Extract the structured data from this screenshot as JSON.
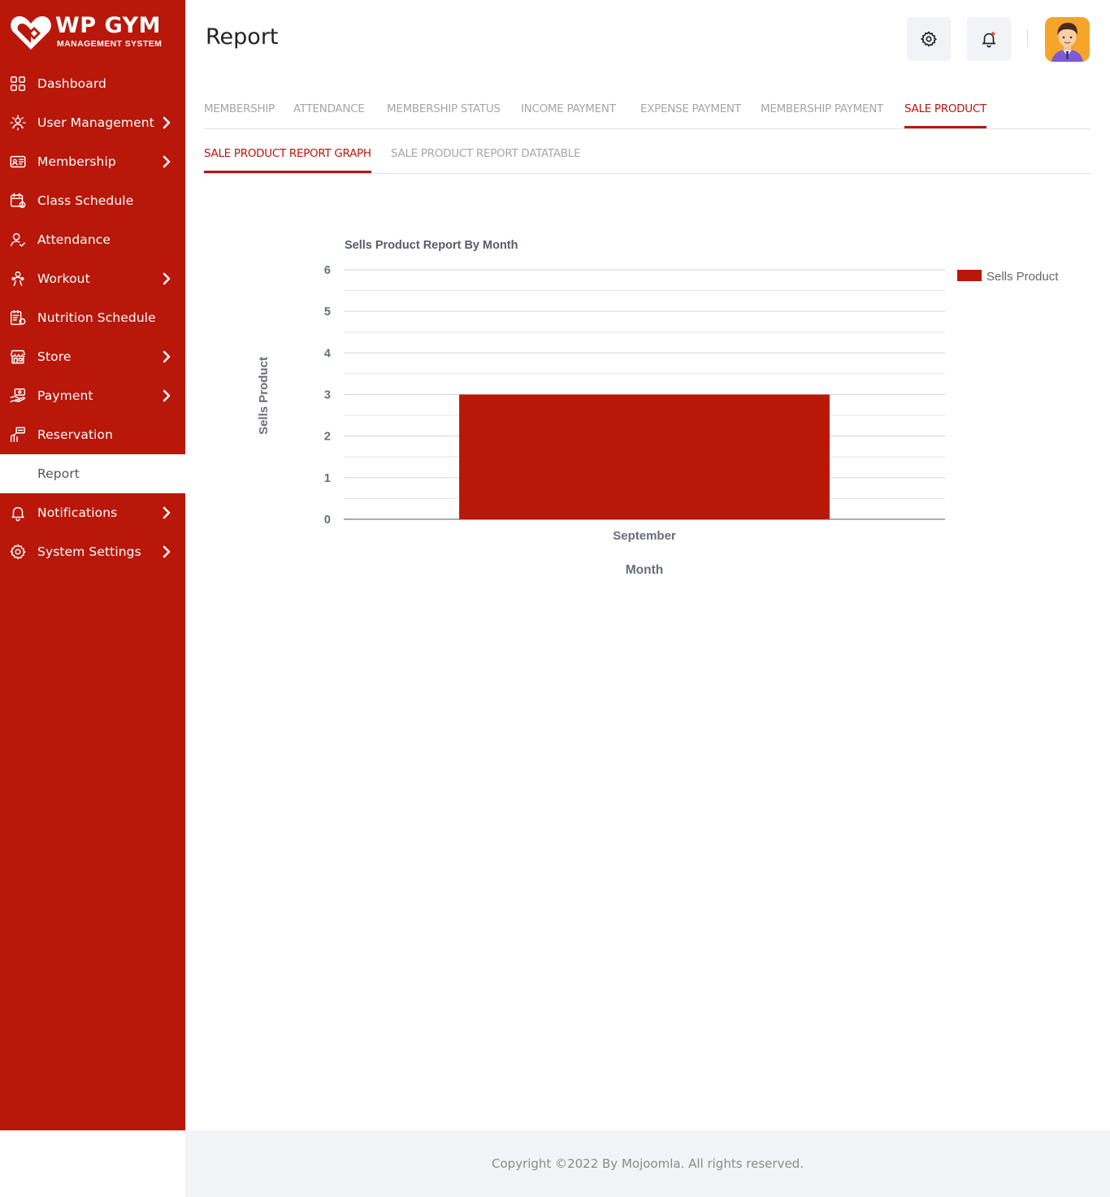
{
  "brand": {
    "title": "WP GYM",
    "subtitle": "MANAGEMENT SYSTEM"
  },
  "sidebar": {
    "items": [
      {
        "label": "Dashboard",
        "icon": "dashboard-icon",
        "has_submenu": false
      },
      {
        "label": "User Management",
        "icon": "users-gear-icon",
        "has_submenu": true
      },
      {
        "label": "Membership",
        "icon": "membership-card-icon",
        "has_submenu": true
      },
      {
        "label": "Class Schedule",
        "icon": "calendar-icon",
        "has_submenu": false
      },
      {
        "label": "Attendance",
        "icon": "user-check-icon",
        "has_submenu": false
      },
      {
        "label": "Workout",
        "icon": "workout-icon",
        "has_submenu": true
      },
      {
        "label": "Nutrition Schedule",
        "icon": "nutrition-icon",
        "has_submenu": false
      },
      {
        "label": "Store",
        "icon": "store-icon",
        "has_submenu": true
      },
      {
        "label": "Payment",
        "icon": "payment-icon",
        "has_submenu": true
      },
      {
        "label": "Reservation",
        "icon": "reservation-icon",
        "has_submenu": false
      },
      {
        "label": "Report",
        "icon": "report-icon",
        "has_submenu": false,
        "active": true
      },
      {
        "label": "Notifications",
        "icon": "bell-icon",
        "has_submenu": true
      },
      {
        "label": "System Settings",
        "icon": "gear-icon",
        "has_submenu": true
      }
    ]
  },
  "header": {
    "title": "Report"
  },
  "tabs": [
    {
      "label": "MEMBERSHIP"
    },
    {
      "label": "ATTENDANCE"
    },
    {
      "label": "MEMBERSHIP STATUS"
    },
    {
      "label": "INCOME PAYMENT"
    },
    {
      "label": "EXPENSE PAYMENT"
    },
    {
      "label": "MEMBERSHIP PAYMENT"
    },
    {
      "label": "SALE PRODUCT",
      "active": true
    }
  ],
  "subtabs": [
    {
      "label": "SALE PRODUCT REPORT GRAPH",
      "active": true
    },
    {
      "label": "SALE PRODUCT REPORT DATATABLE"
    }
  ],
  "chart_data": {
    "type": "bar",
    "title": "Sells Product Report By Month",
    "categories": [
      "September"
    ],
    "series": [
      {
        "name": "Sells Product",
        "values": [
          3
        ],
        "color": "#b9170a"
      }
    ],
    "xlabel": "Month",
    "ylabel": "Sells Product",
    "ylim": [
      0,
      6
    ],
    "yticks": [
      0,
      1,
      2,
      3,
      4,
      5,
      6
    ],
    "grid": true,
    "legend": "right"
  },
  "colors": {
    "brand": "#b9170a",
    "footer_bg": "#f2f4f8",
    "notification_dot": "#e74c3c"
  },
  "footer": {
    "text": "Copyright ©2022 By Mojoomla. All rights reserved."
  }
}
